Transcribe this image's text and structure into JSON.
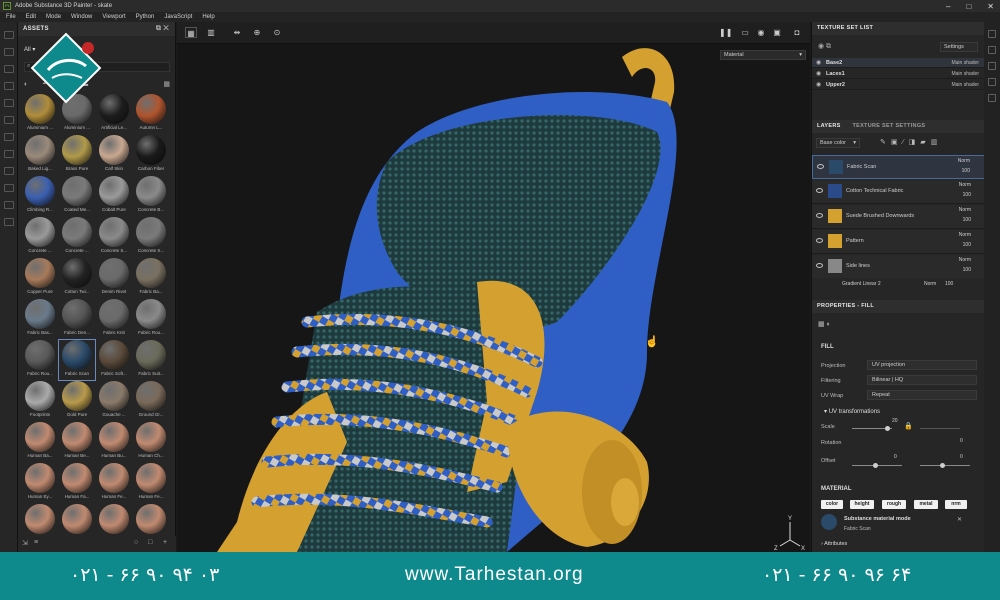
{
  "window": {
    "title": "Adobe Substance 3D Painter - skate"
  },
  "menu": [
    "File",
    "Edit",
    "Mode",
    "Window",
    "Viewport",
    "Python",
    "JavaScript",
    "Help"
  ],
  "assets": {
    "title": "ASSETS",
    "filter_label": "All",
    "items": [
      {
        "label": "Aluminium ...",
        "color": "#b08d3a"
      },
      {
        "label": "Aluminium ...",
        "color": "#6a6a6a"
      },
      {
        "label": "Artificial Le...",
        "color": "#1d1d1d"
      },
      {
        "label": "Autumn L...",
        "color": "#b0552e"
      },
      {
        "label": "Baked Lig...",
        "color": "#9a8a7a"
      },
      {
        "label": "Brass Pure",
        "color": "#b09a4a"
      },
      {
        "label": "Calf Skin",
        "color": "#c8a890"
      },
      {
        "label": "Carbon Fiber",
        "color": "#1a1a1a"
      },
      {
        "label": "Climbing R...",
        "color": "#3b5fb0"
      },
      {
        "label": "Coated Me...",
        "color": "#7a7a7a"
      },
      {
        "label": "Cobalt Pure",
        "color": "#9a9a9a"
      },
      {
        "label": "Concrete B...",
        "color": "#8a8a8a"
      },
      {
        "label": "Concrete ...",
        "color": "#9a9a9a"
      },
      {
        "label": "Concrete ...",
        "color": "#7a7a7a"
      },
      {
        "label": "Concrete S...",
        "color": "#8a8a8a"
      },
      {
        "label": "Concrete S...",
        "color": "#7a7a7a"
      },
      {
        "label": "Copper Pure",
        "color": "#a77a5a"
      },
      {
        "label": "Cotton Twi...",
        "color": "#222"
      },
      {
        "label": "Denim Rivet",
        "color": "#6a6a6a"
      },
      {
        "label": "Fabric Ba...",
        "color": "#7a7060"
      },
      {
        "label": "Fabric Bas...",
        "color": "#6a7a8a"
      },
      {
        "label": "Fabric Den...",
        "color": "#555"
      },
      {
        "label": "Fabric Knit",
        "color": "#6a6a6a"
      },
      {
        "label": "Fabric Rou...",
        "color": "#8a8a8a"
      },
      {
        "label": "Fabric Rou...",
        "color": "#5a5a5a"
      },
      {
        "label": "Fabric Scan",
        "color": "#2a4a6a"
      },
      {
        "label": "Fabric Soft...",
        "color": "#5a4a3a"
      },
      {
        "label": "Fabric Suit...",
        "color": "#6a6a5a"
      },
      {
        "label": "Footprints",
        "color": "#aaa"
      },
      {
        "label": "Gold Pure",
        "color": "#b89a4a"
      },
      {
        "label": "Gouache ...",
        "color": "#8a7a6a"
      },
      {
        "label": "Ground Gr...",
        "color": "#7a6a5a"
      },
      {
        "label": "Human Ba...",
        "color": "#c08a70"
      },
      {
        "label": "Human Be...",
        "color": "#c08a70"
      },
      {
        "label": "Human Bu...",
        "color": "#c08a70"
      },
      {
        "label": "Human Ch...",
        "color": "#c08a70"
      },
      {
        "label": "Human Ey...",
        "color": "#c08a70"
      },
      {
        "label": "Human Fa...",
        "color": "#c08a70"
      },
      {
        "label": "Human Fe...",
        "color": "#c08a70"
      },
      {
        "label": "Human Fe...",
        "color": "#c08a70"
      },
      {
        "label": "",
        "color": "#c08a70"
      },
      {
        "label": "",
        "color": "#c08a70"
      },
      {
        "label": "",
        "color": "#c08a70"
      },
      {
        "label": "",
        "color": "#c08a70"
      }
    ]
  },
  "viewport": {
    "mode": "Material"
  },
  "texture_set_list": {
    "title": "TEXTURE SET LIST",
    "settings_label": "Settings",
    "sets": [
      {
        "name": "Base2",
        "shader": "Main shader"
      },
      {
        "name": "Laces1",
        "shader": "Main shader"
      },
      {
        "name": "Upper2",
        "shader": "Main shader"
      }
    ]
  },
  "layers": {
    "tab_layers": "LAYERS",
    "tab_tss": "TEXTURE SET SETTINGS",
    "channel": "Base color",
    "rows": [
      {
        "name": "Fabric Scan",
        "blend": "Norm",
        "opacity": "100",
        "thumb": "#2a4a6a"
      },
      {
        "name": "Cotton Technical Fabric",
        "blend": "Norm",
        "opacity": "100",
        "thumb": "#2a4a8a"
      },
      {
        "name": "Suede Brushed Downwards",
        "blend": "Norm",
        "opacity": "100",
        "thumb": "#d4a030"
      },
      {
        "name": "Pattern",
        "blend": "Norm",
        "opacity": "100",
        "thumb": "#d4a030"
      },
      {
        "name": "Side lines",
        "blend": "Norm",
        "opacity": "100",
        "thumb": "#888"
      }
    ],
    "subrow": {
      "name": "Gradient Linear 2",
      "blend": "Norm",
      "opacity": "100"
    }
  },
  "properties": {
    "title": "PROPERTIES - FILL",
    "section": "FILL",
    "projection_label": "Projection",
    "projection": "UV projection",
    "filtering_label": "Filtering",
    "filtering": "Bilinear | HQ",
    "uvwrap_label": "UV Wrap",
    "uvwrap": "Repeat",
    "uvt_title": "UV transformations",
    "scale_label": "Scale",
    "scale_value": "20",
    "rotation_label": "Rotation",
    "rotation_value": "0",
    "offset_label": "Offset",
    "offset_x": "0",
    "offset_y": "0",
    "material_title": "MATERIAL",
    "channels": [
      "color",
      "height",
      "rough",
      "metal",
      "nrm"
    ],
    "material_mode": "Substance material mode",
    "material_name": "Fabric Scan",
    "attributes": "Attributes"
  },
  "footer": {
    "phone_left": "۰۲۱ - ۶۶ ۹۰ ۹۴ ۰۳",
    "url": "www.Tarhestan.org",
    "phone_right": "۰۲۱ - ۶۶ ۹۰ ۹۶ ۶۴"
  },
  "colors": {
    "accent": "#0e8a8c",
    "blue": "#2f5fc4",
    "yellow": "#d4a030"
  }
}
